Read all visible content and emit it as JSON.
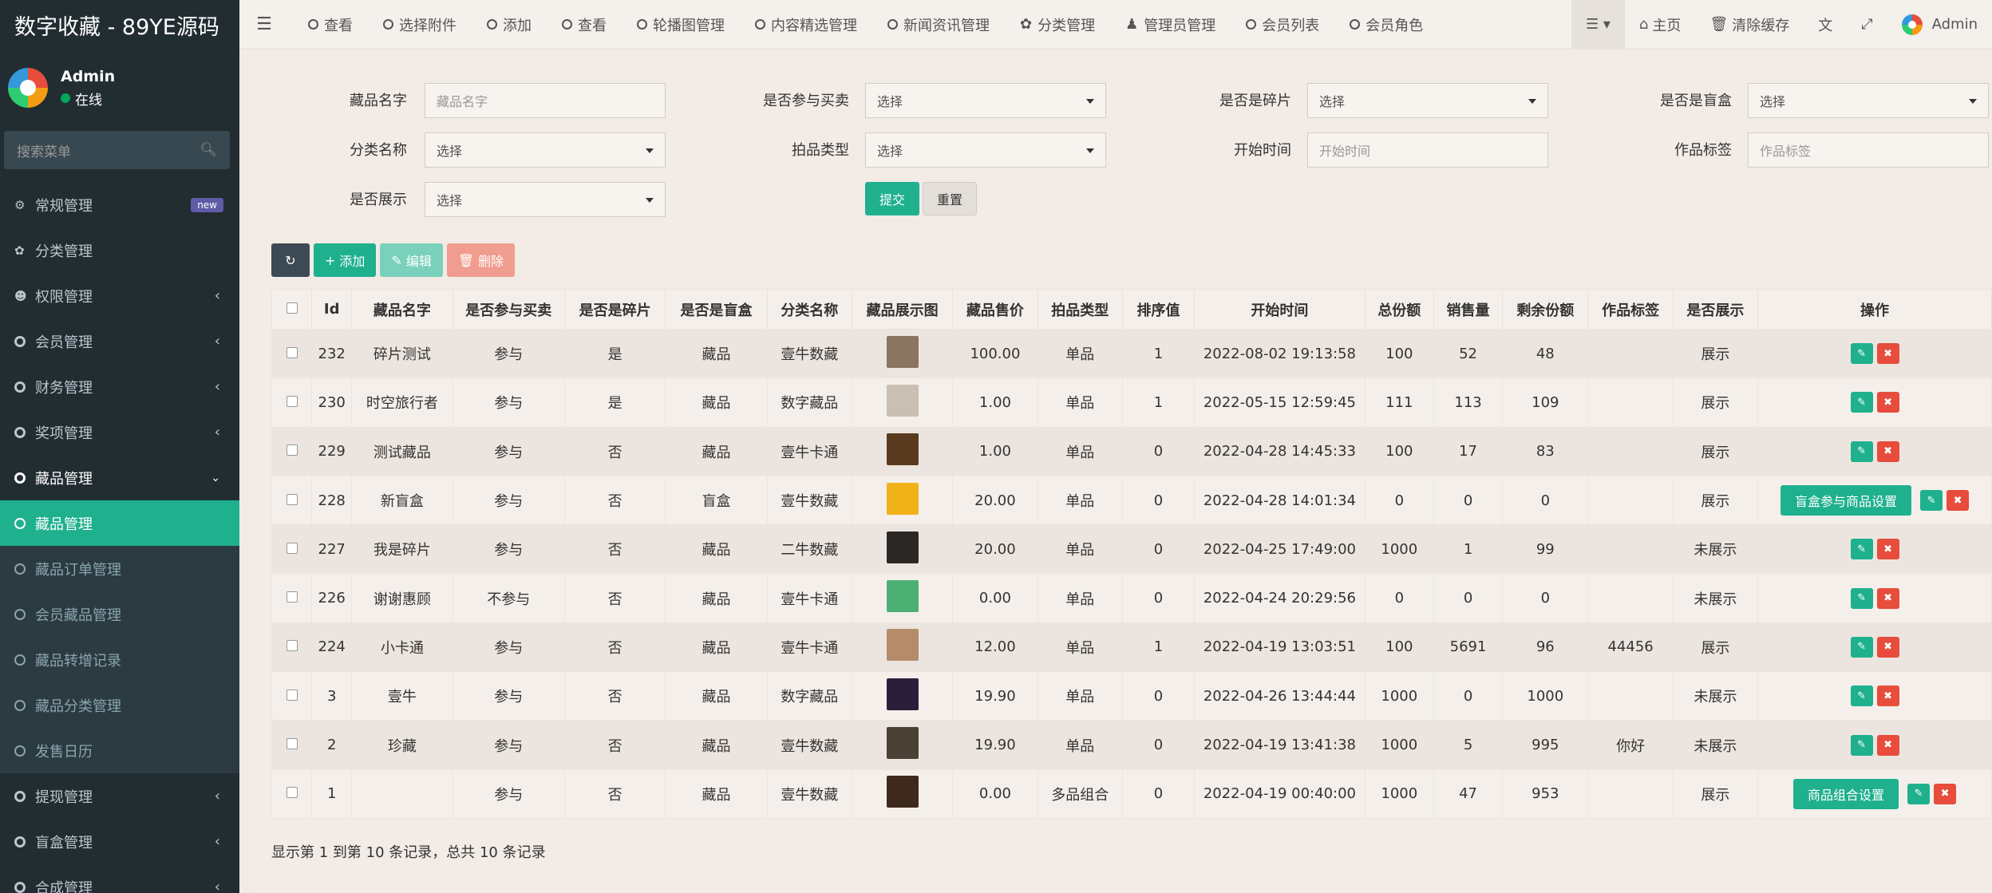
{
  "app": {
    "title": "数字收藏 - 89YE源码"
  },
  "user": {
    "name": "Admin",
    "status": "在线"
  },
  "search": {
    "placeholder": "搜索菜单"
  },
  "menu": [
    {
      "label": "常规管理",
      "icon": "cogs-icon",
      "badge": "new"
    },
    {
      "label": "分类管理",
      "icon": "leaf-icon"
    },
    {
      "label": "权限管理",
      "icon": "users-icon"
    },
    {
      "label": "会员管理",
      "icon": "circle-icon"
    },
    {
      "label": "财务管理",
      "icon": "circle-icon"
    },
    {
      "label": "奖项管理",
      "icon": "circle-icon"
    },
    {
      "label": "藏品管理",
      "icon": "circle-icon"
    }
  ],
  "submenu": [
    {
      "label": "藏品管理"
    },
    {
      "label": "藏品订单管理"
    },
    {
      "label": "会员藏品管理"
    },
    {
      "label": "藏品转增记录"
    },
    {
      "label": "藏品分类管理"
    },
    {
      "label": "发售日历"
    }
  ],
  "menu_after": [
    {
      "label": "提现管理"
    },
    {
      "label": "盲盒管理"
    },
    {
      "label": "合成管理"
    }
  ],
  "topnav": {
    "items": [
      "查看",
      "选择附件",
      "添加",
      "查看",
      "轮播图管理",
      "内容精选管理",
      "新闻资讯管理",
      "分类管理",
      "管理员管理",
      "会员列表",
      "会员角色"
    ],
    "home": "主页",
    "clear_cache": "清除缓存",
    "user": "Admin"
  },
  "filters": {
    "name_label": "藏品名字",
    "name_placeholder": "藏品名字",
    "trade_label": "是否参与买卖",
    "trade_value": "选择",
    "frag_label": "是否是碎片",
    "frag_value": "选择",
    "box_label": "是否是盲盒",
    "box_value": "选择",
    "cat_label": "分类名称",
    "cat_value": "选择",
    "auction_label": "拍品类型",
    "auction_value": "选择",
    "start_label": "开始时间",
    "start_placeholder": "开始时间",
    "tag_label": "作品标签",
    "tag_placeholder": "作品标签",
    "show_label": "是否展示",
    "show_value": "选择",
    "submit": "提交",
    "reset": "重置"
  },
  "toolbar": {
    "add": "添加",
    "edit": "编辑",
    "delete": "删除"
  },
  "table": {
    "headers": [
      "Id",
      "藏品名字",
      "是否参与买卖",
      "是否是碎片",
      "是否是盲盒",
      "分类名称",
      "藏品展示图",
      "藏品售价",
      "拍品类型",
      "排序值",
      "开始时间",
      "总份额",
      "销售量",
      "剩余份额",
      "作品标签",
      "是否展示",
      "操作"
    ],
    "rows": [
      {
        "id": "232",
        "name": "碎片测试",
        "trade": "参与",
        "frag": "是",
        "box": "藏品",
        "cat": "壹牛数藏",
        "img_color": "#8a7560",
        "price": "100.00",
        "type": "单品",
        "sort": "1",
        "start": "2022-08-02 19:13:58",
        "total": "100",
        "sold": "52",
        "left": "48",
        "tag": "",
        "show": "展示",
        "extra": ""
      },
      {
        "id": "230",
        "name": "时空旅行者",
        "trade": "参与",
        "frag": "是",
        "box": "藏品",
        "cat": "数字藏品",
        "img_color": "#c9bfb2",
        "price": "1.00",
        "type": "单品",
        "sort": "1",
        "start": "2022-05-15 12:59:45",
        "total": "111",
        "sold": "113",
        "left": "109",
        "tag": "",
        "show": "展示",
        "extra": ""
      },
      {
        "id": "229",
        "name": "测试藏品",
        "trade": "参与",
        "frag": "否",
        "box": "藏品",
        "cat": "壹牛卡通",
        "img_color": "#5a3a1e",
        "price": "1.00",
        "type": "单品",
        "sort": "0",
        "start": "2022-04-28 14:45:33",
        "total": "100",
        "sold": "17",
        "left": "83",
        "tag": "",
        "show": "展示",
        "extra": ""
      },
      {
        "id": "228",
        "name": "新盲盒",
        "trade": "参与",
        "frag": "否",
        "box": "盲盒",
        "cat": "壹牛数藏",
        "img_color": "#f1b219",
        "price": "20.00",
        "type": "单品",
        "sort": "0",
        "start": "2022-04-28 14:01:34",
        "total": "0",
        "sold": "0",
        "left": "0",
        "tag": "",
        "show": "展示",
        "extra": "盲盒参与商品设置"
      },
      {
        "id": "227",
        "name": "我是碎片",
        "trade": "参与",
        "frag": "否",
        "box": "藏品",
        "cat": "二牛数藏",
        "img_color": "#2b2724",
        "price": "20.00",
        "type": "单品",
        "sort": "0",
        "start": "2022-04-25 17:49:00",
        "total": "1000",
        "sold": "1",
        "left": "99",
        "tag": "",
        "show": "未展示",
        "extra": ""
      },
      {
        "id": "226",
        "name": "谢谢惠顾",
        "trade": "不参与",
        "frag": "否",
        "box": "藏品",
        "cat": "壹牛卡通",
        "img_color": "#4caf73",
        "price": "0.00",
        "type": "单品",
        "sort": "0",
        "start": "2022-04-24 20:29:56",
        "total": "0",
        "sold": "0",
        "left": "0",
        "tag": "",
        "show": "未展示",
        "extra": ""
      },
      {
        "id": "224",
        "name": "小卡通",
        "trade": "参与",
        "frag": "否",
        "box": "藏品",
        "cat": "壹牛卡通",
        "img_color": "#b58c6a",
        "price": "12.00",
        "type": "单品",
        "sort": "1",
        "start": "2022-04-19 13:03:51",
        "total": "100",
        "sold": "5691",
        "left": "96",
        "tag": "44456",
        "show": "展示",
        "extra": ""
      },
      {
        "id": "3",
        "name": "壹牛",
        "trade": "参与",
        "frag": "否",
        "box": "藏品",
        "cat": "数字藏品",
        "img_color": "#2a1f3a",
        "price": "19.90",
        "type": "单品",
        "sort": "0",
        "start": "2022-04-26 13:44:44",
        "total": "1000",
        "sold": "0",
        "left": "1000",
        "tag": "",
        "show": "未展示",
        "extra": ""
      },
      {
        "id": "2",
        "name": "珍藏",
        "trade": "参与",
        "frag": "否",
        "box": "藏品",
        "cat": "壹牛数藏",
        "img_color": "#4a4035",
        "price": "19.90",
        "type": "单品",
        "sort": "0",
        "start": "2022-04-19 13:41:38",
        "total": "1000",
        "sold": "5",
        "left": "995",
        "tag": "你好",
        "show": "未展示",
        "extra": ""
      },
      {
        "id": "1",
        "name": "",
        "trade": "参与",
        "frag": "否",
        "box": "藏品",
        "cat": "壹牛数藏",
        "img_color": "#3d2a1c",
        "price": "0.00",
        "type": "多品组合",
        "sort": "0",
        "start": "2022-04-19 00:40:00",
        "total": "1000",
        "sold": "47",
        "left": "953",
        "tag": "",
        "show": "展示",
        "extra": "商品组合设置"
      }
    ]
  },
  "pager": {
    "text": "显示第 1 到第 10 条记录，总共 10 条记录"
  },
  "colors": {
    "accent": "#1fb08e",
    "danger": "#e74c3c",
    "sidebar": "#222d32"
  }
}
